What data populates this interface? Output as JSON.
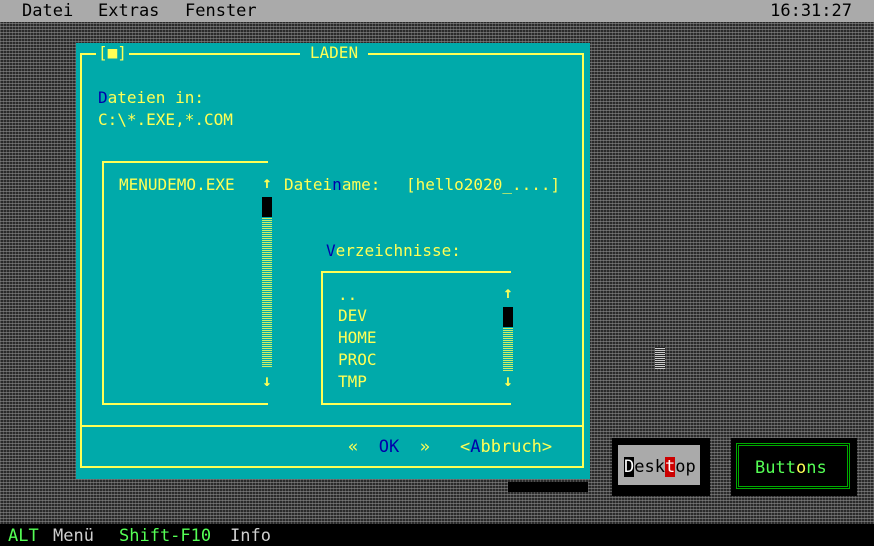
{
  "menubar": {
    "items": [
      "Datei",
      "Extras",
      "Fenster"
    ],
    "clock": "16:31:27"
  },
  "dialog": {
    "title": "LADEN",
    "close_box": "[■]",
    "files_label_hot": "D",
    "files_label_rest": "ateien in:",
    "path": "C:\\*.EXE,*.COM",
    "files": [
      "MENUDEMO.EXE"
    ],
    "filename_label_a": "Datei",
    "filename_label_hot": "n",
    "filename_label_b": "ame:",
    "filename_value": "[hello2020_....]",
    "dirs_label_hot": "V",
    "dirs_label_rest": "erzeichnisse:",
    "dirs": [
      "..",
      "DEV",
      "HOME",
      "PROC",
      "TMP"
    ],
    "ok_left": "«",
    "ok_label": "OK",
    "ok_right": "»",
    "cancel_open": "<",
    "cancel_hot": "A",
    "cancel_rest": "bbruch>",
    "arrow_up": "↑",
    "arrow_down": "↓"
  },
  "desktop": {
    "desktop_btn": {
      "p1": "D",
      "p2": "esk",
      "hot": "t",
      "p3": "op"
    },
    "buttons_btn": {
      "p1": "Butt",
      "hot": "o",
      "p2": "ns"
    }
  },
  "statusbar": {
    "alt_key": "ALT",
    "alt_label": "Menü",
    "f10_key": "Shift-F10",
    "f10_label": "Info"
  },
  "colors": {
    "dialog_bg": "#00aaaa",
    "dialog_fg": "#ffff55",
    "hotkey": "#0000aa",
    "menubar_bg": "#aaaaaa",
    "status_key": "#55ff55"
  }
}
